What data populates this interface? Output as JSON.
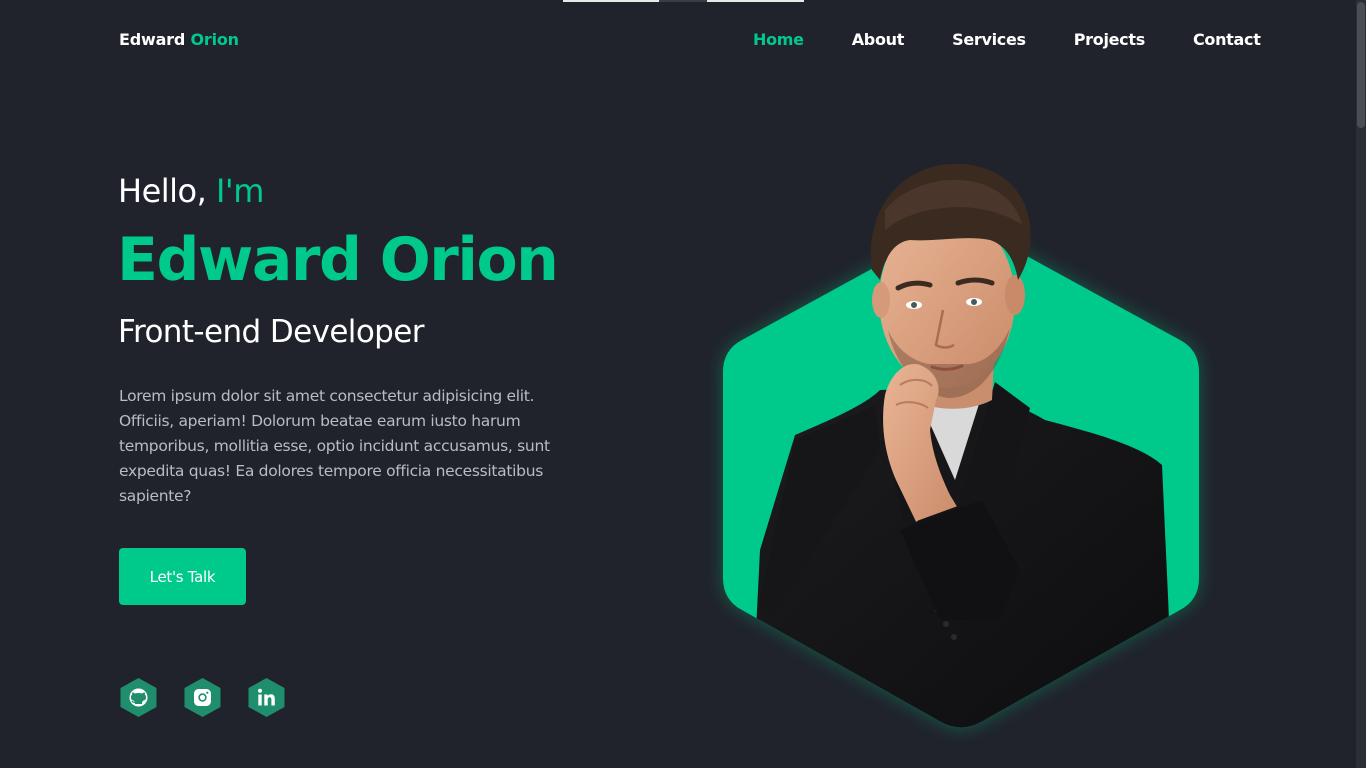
{
  "header": {
    "logo_first": "Edward",
    "logo_second": "Orion",
    "nav": [
      {
        "label": "Home",
        "active": true
      },
      {
        "label": "About",
        "active": false
      },
      {
        "label": "Services",
        "active": false
      },
      {
        "label": "Projects",
        "active": false
      },
      {
        "label": "Contact",
        "active": false
      }
    ]
  },
  "hero": {
    "greeting": "Hello,",
    "greeting_accent": "I'm",
    "name": "Edward Orion",
    "role": "Front-end Developer",
    "description": "Lorem ipsum dolor sit amet consectetur adipisicing elit. Officiis, aperiam! Dolorum beatae earum iusto harum temporibus, mollitia esse, optio incidunt accusamus, sunt expedita quas! Ea dolores tempore officia necessitatibus sapiente?",
    "cta_label": "Let's Talk"
  },
  "socials": [
    {
      "icon": "github-icon"
    },
    {
      "icon": "instagram-icon"
    },
    {
      "icon": "linkedin-icon"
    }
  ],
  "colors": {
    "background": "#20232b",
    "accent": "#00c98c",
    "social_bg": "#1f8e6c",
    "text_muted": "#b9bcc3"
  }
}
